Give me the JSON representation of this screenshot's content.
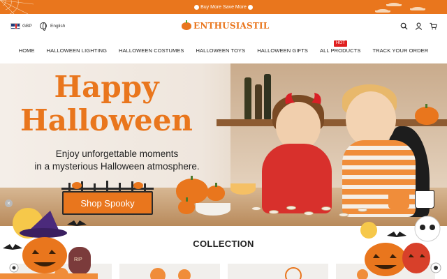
{
  "announcement": {
    "text": "Buy More Save More"
  },
  "header": {
    "currency": "GBP",
    "language": "English",
    "brand": "ENTHUSIASTIL"
  },
  "icons": {
    "search": "search-icon",
    "account": "user-icon",
    "cart": "cart-icon"
  },
  "nav": {
    "items": [
      {
        "label": "HOME"
      },
      {
        "label": "HALLOWEEN LIGHTING"
      },
      {
        "label": "HALLOWEEN COSTUMES"
      },
      {
        "label": "HALLOWEEN TOYS"
      },
      {
        "label": "HALLOWEEN GIFTS"
      },
      {
        "label": "ALL PRODUCTS",
        "badge": "HOT"
      },
      {
        "label": "TRACK YOUR ORDER"
      }
    ]
  },
  "hero": {
    "title_line1": "Happy",
    "title_line2": "Halloween",
    "subtitle_line1": "Enjoy unforgettable moments",
    "subtitle_line2": "in a mysterious Halloween atmosphere.",
    "cta": "Shop Spooky",
    "accent_color": "#e9761d"
  },
  "collection": {
    "title": "COLLECTION"
  },
  "floating": {
    "tombstone_text": "RIP",
    "close_label": "×"
  }
}
